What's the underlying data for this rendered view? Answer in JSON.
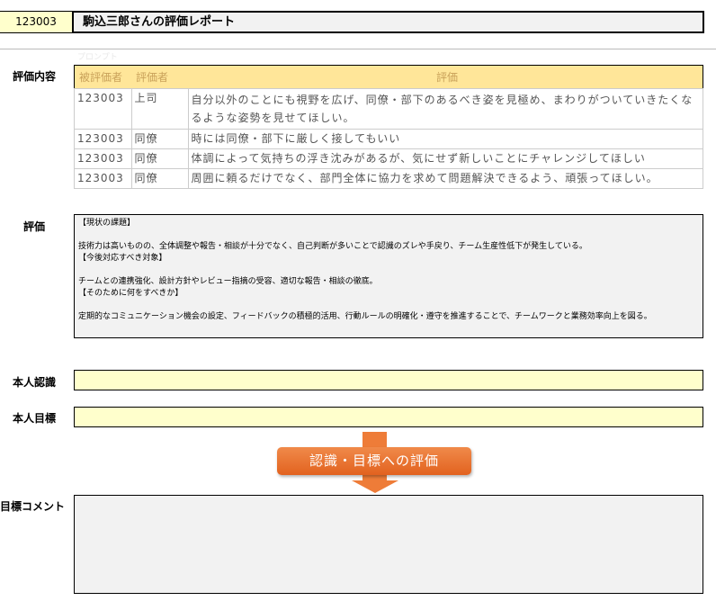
{
  "header": {
    "employee_id": "123003",
    "title": "駒込三郎さんの評価レポート"
  },
  "prompt_label": "プロンプト",
  "evaluation_content": {
    "label": "評価内容",
    "columns": [
      "被評価者",
      "評価者",
      "評価"
    ],
    "rows": [
      {
        "target": "123003",
        "evaluator": "上司",
        "comment": "自分以外のことにも視野を広げ、同僚・部下のあるべき姿を見極め、まわりがついていきたくなるような姿勢を見せてほしい。"
      },
      {
        "target": "123003",
        "evaluator": "同僚",
        "comment": "時には同僚・部下に厳しく接してもいい"
      },
      {
        "target": "123003",
        "evaluator": "同僚",
        "comment": "体調によって気持ちの浮き沈みがあるが、気にせず新しいことにチャレンジしてほしい"
      },
      {
        "target": "123003",
        "evaluator": "同僚",
        "comment": "周囲に頼るだけでなく、部門全体に協力を求めて問題解決できるよう、頑張ってほしい。"
      }
    ]
  },
  "evaluation": {
    "label": "評価",
    "text": "【現状の課題】\n\n技術力は高いものの、全体調整や報告・相談が十分でなく、自己判断が多いことで認識のズレや手戻り、チーム生産性低下が発生している。\n【今後対応すべき対象】\n\nチームとの連携強化、設計方針やレビュー指摘の受容、適切な報告・相談の徹底。\n【そのために何をすべきか】\n\n定期的なコミュニケーション機会の設定、フィードバックの積極的活用、行動ルールの明確化・遵守を推進することで、チームワークと業務効率向上を図る。"
  },
  "self_recognition": {
    "label": "本人認識",
    "value": ""
  },
  "self_goal": {
    "label": "本人目標",
    "value": ""
  },
  "action_button": "認識・目標への評価",
  "goal_comment": {
    "label": "目標コメント",
    "value": ""
  }
}
